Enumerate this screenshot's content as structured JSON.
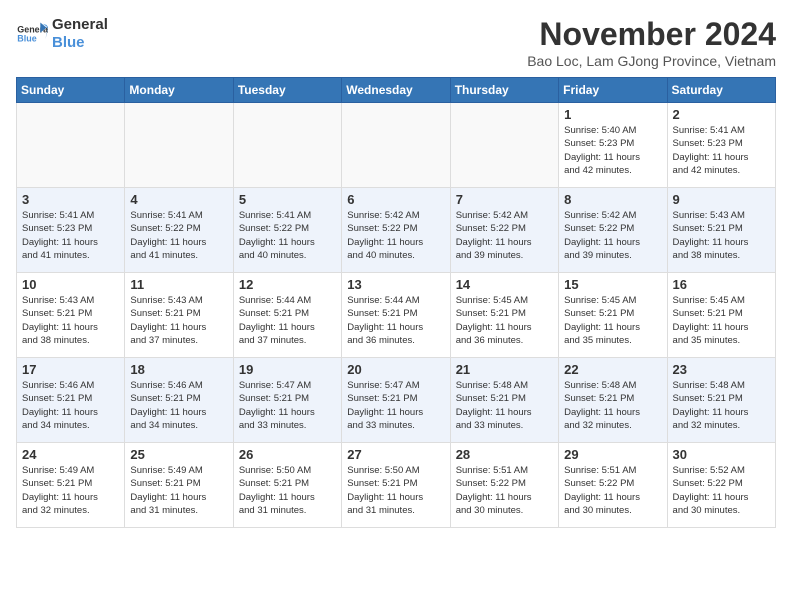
{
  "logo": {
    "line1": "General",
    "line2": "Blue"
  },
  "title": "November 2024",
  "location": "Bao Loc, Lam GJong Province, Vietnam",
  "weekdays": [
    "Sunday",
    "Monday",
    "Tuesday",
    "Wednesday",
    "Thursday",
    "Friday",
    "Saturday"
  ],
  "weeks": [
    [
      {
        "day": "",
        "info": ""
      },
      {
        "day": "",
        "info": ""
      },
      {
        "day": "",
        "info": ""
      },
      {
        "day": "",
        "info": ""
      },
      {
        "day": "",
        "info": ""
      },
      {
        "day": "1",
        "info": "Sunrise: 5:40 AM\nSunset: 5:23 PM\nDaylight: 11 hours\nand 42 minutes."
      },
      {
        "day": "2",
        "info": "Sunrise: 5:41 AM\nSunset: 5:23 PM\nDaylight: 11 hours\nand 42 minutes."
      }
    ],
    [
      {
        "day": "3",
        "info": "Sunrise: 5:41 AM\nSunset: 5:23 PM\nDaylight: 11 hours\nand 41 minutes."
      },
      {
        "day": "4",
        "info": "Sunrise: 5:41 AM\nSunset: 5:22 PM\nDaylight: 11 hours\nand 41 minutes."
      },
      {
        "day": "5",
        "info": "Sunrise: 5:41 AM\nSunset: 5:22 PM\nDaylight: 11 hours\nand 40 minutes."
      },
      {
        "day": "6",
        "info": "Sunrise: 5:42 AM\nSunset: 5:22 PM\nDaylight: 11 hours\nand 40 minutes."
      },
      {
        "day": "7",
        "info": "Sunrise: 5:42 AM\nSunset: 5:22 PM\nDaylight: 11 hours\nand 39 minutes."
      },
      {
        "day": "8",
        "info": "Sunrise: 5:42 AM\nSunset: 5:22 PM\nDaylight: 11 hours\nand 39 minutes."
      },
      {
        "day": "9",
        "info": "Sunrise: 5:43 AM\nSunset: 5:21 PM\nDaylight: 11 hours\nand 38 minutes."
      }
    ],
    [
      {
        "day": "10",
        "info": "Sunrise: 5:43 AM\nSunset: 5:21 PM\nDaylight: 11 hours\nand 38 minutes."
      },
      {
        "day": "11",
        "info": "Sunrise: 5:43 AM\nSunset: 5:21 PM\nDaylight: 11 hours\nand 37 minutes."
      },
      {
        "day": "12",
        "info": "Sunrise: 5:44 AM\nSunset: 5:21 PM\nDaylight: 11 hours\nand 37 minutes."
      },
      {
        "day": "13",
        "info": "Sunrise: 5:44 AM\nSunset: 5:21 PM\nDaylight: 11 hours\nand 36 minutes."
      },
      {
        "day": "14",
        "info": "Sunrise: 5:45 AM\nSunset: 5:21 PM\nDaylight: 11 hours\nand 36 minutes."
      },
      {
        "day": "15",
        "info": "Sunrise: 5:45 AM\nSunset: 5:21 PM\nDaylight: 11 hours\nand 35 minutes."
      },
      {
        "day": "16",
        "info": "Sunrise: 5:45 AM\nSunset: 5:21 PM\nDaylight: 11 hours\nand 35 minutes."
      }
    ],
    [
      {
        "day": "17",
        "info": "Sunrise: 5:46 AM\nSunset: 5:21 PM\nDaylight: 11 hours\nand 34 minutes."
      },
      {
        "day": "18",
        "info": "Sunrise: 5:46 AM\nSunset: 5:21 PM\nDaylight: 11 hours\nand 34 minutes."
      },
      {
        "day": "19",
        "info": "Sunrise: 5:47 AM\nSunset: 5:21 PM\nDaylight: 11 hours\nand 33 minutes."
      },
      {
        "day": "20",
        "info": "Sunrise: 5:47 AM\nSunset: 5:21 PM\nDaylight: 11 hours\nand 33 minutes."
      },
      {
        "day": "21",
        "info": "Sunrise: 5:48 AM\nSunset: 5:21 PM\nDaylight: 11 hours\nand 33 minutes."
      },
      {
        "day": "22",
        "info": "Sunrise: 5:48 AM\nSunset: 5:21 PM\nDaylight: 11 hours\nand 32 minutes."
      },
      {
        "day": "23",
        "info": "Sunrise: 5:48 AM\nSunset: 5:21 PM\nDaylight: 11 hours\nand 32 minutes."
      }
    ],
    [
      {
        "day": "24",
        "info": "Sunrise: 5:49 AM\nSunset: 5:21 PM\nDaylight: 11 hours\nand 32 minutes."
      },
      {
        "day": "25",
        "info": "Sunrise: 5:49 AM\nSunset: 5:21 PM\nDaylight: 11 hours\nand 31 minutes."
      },
      {
        "day": "26",
        "info": "Sunrise: 5:50 AM\nSunset: 5:21 PM\nDaylight: 11 hours\nand 31 minutes."
      },
      {
        "day": "27",
        "info": "Sunrise: 5:50 AM\nSunset: 5:21 PM\nDaylight: 11 hours\nand 31 minutes."
      },
      {
        "day": "28",
        "info": "Sunrise: 5:51 AM\nSunset: 5:22 PM\nDaylight: 11 hours\nand 30 minutes."
      },
      {
        "day": "29",
        "info": "Sunrise: 5:51 AM\nSunset: 5:22 PM\nDaylight: 11 hours\nand 30 minutes."
      },
      {
        "day": "30",
        "info": "Sunrise: 5:52 AM\nSunset: 5:22 PM\nDaylight: 11 hours\nand 30 minutes."
      }
    ]
  ]
}
